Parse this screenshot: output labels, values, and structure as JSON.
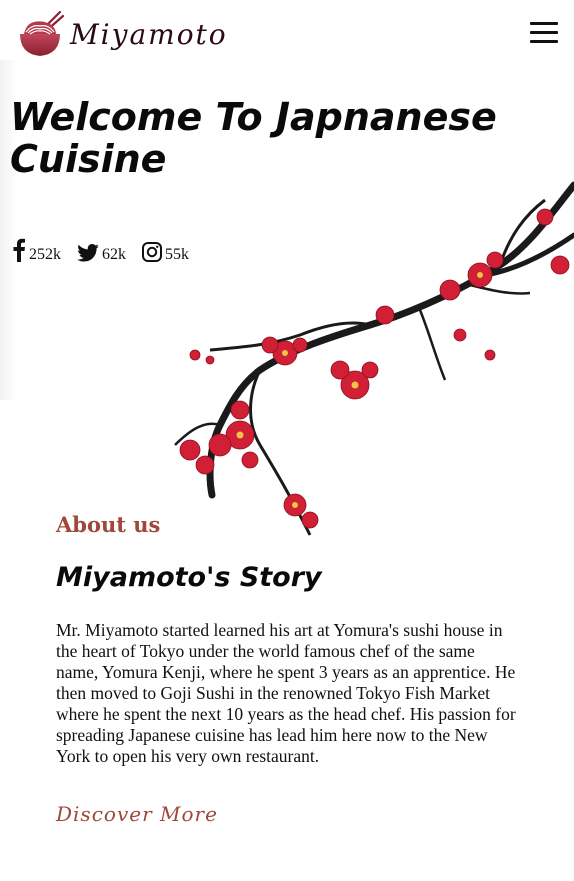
{
  "brand": {
    "name": "Miyamoto",
    "logo_icon": "ramen-bowl-icon",
    "accent": "#a0473a"
  },
  "nav": {
    "menu_icon": "hamburger-menu-icon"
  },
  "hero": {
    "title": "Welcome To Japnanese Cuisine"
  },
  "social": [
    {
      "icon": "facebook-icon",
      "count": "252k"
    },
    {
      "icon": "twitter-icon",
      "count": "62k"
    },
    {
      "icon": "instagram-icon",
      "count": "55k"
    }
  ],
  "about": {
    "eyebrow": "About us",
    "title": "Miyamoto's Story",
    "body": "Mr. Miyamoto started learned his art at Yomura's sushi house in the heart of Tokyo under the world famous chef of the same name, Yomura Kenji, where he spent 3 years as an apprentice. He then moved to Goji Sushi in the renowned Tokyo Fish Market where he spent the next 10 years as the head chef. His passion for spreading Japanese cuisine has lead him here now to the New York to open his very own restaurant.",
    "cta": "Discover More"
  }
}
